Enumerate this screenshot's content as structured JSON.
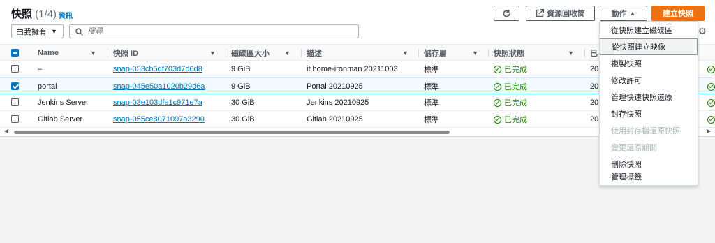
{
  "header": {
    "title": "快照",
    "count": "(1/4)",
    "info": "資訊"
  },
  "toolbar": {
    "recycle_label": "資源回收筒",
    "actions_label": "動作",
    "create_label": "建立快照"
  },
  "filter": {
    "owner_value": "由我擁有",
    "search_placeholder": "搜尋"
  },
  "columns": [
    "Name",
    "快照 ID",
    "磁碟區大小",
    "描述",
    "儲存層",
    "快照狀態",
    "已"
  ],
  "rows": [
    {
      "name": "–",
      "id": "snap-053cb5df703d7d6d8",
      "size": "9 GiB",
      "desc": "it home-ironman 20211003",
      "tier": "標準",
      "status": "已完成",
      "started": "20",
      "selected": false
    },
    {
      "name": "portal",
      "id": "snap-045e50a1020b29d6a",
      "size": "9 GiB",
      "desc": "Portal 20210925",
      "tier": "標準",
      "status": "已完成",
      "started": "20",
      "selected": true
    },
    {
      "name": "Jenkins Server",
      "id": "snap-03e103dfe1c971e7a",
      "size": "30 GiB",
      "desc": "Jenkins 20210925",
      "tier": "標準",
      "status": "已完成",
      "started": "20",
      "selected": false
    },
    {
      "name": "Gitlab Server",
      "id": "snap-055ce8071097a3290",
      "size": "30 GiB",
      "desc": "Gitlab 20210925",
      "tier": "標準",
      "status": "已完成",
      "started": "20",
      "selected": false
    }
  ],
  "actions_menu": [
    {
      "label": "從快照建立磁碟區",
      "disabled": false
    },
    {
      "label": "從快照建立映像",
      "disabled": false,
      "hover": true
    },
    {
      "label": "複製快照",
      "disabled": false
    },
    {
      "label": "修改許可",
      "disabled": false
    },
    {
      "label": "管理快速快照還原",
      "disabled": false
    },
    {
      "label": "封存快照",
      "disabled": false
    },
    {
      "label": "使用封存檔還原快照",
      "disabled": true
    },
    {
      "label": "變更還原期間",
      "disabled": true
    },
    {
      "label": "刪除快照",
      "disabled": false
    },
    {
      "label": "管理標籤",
      "disabled": false
    }
  ],
  "icons": {
    "refresh": "refresh-icon",
    "external": "external-link-icon",
    "caret_up": "caret-up-icon",
    "search": "search-icon",
    "gear": "gear-icon",
    "check_circle": "check-circle-icon"
  },
  "colors": {
    "primary": "#ec7211",
    "link": "#0073bb",
    "success": "#1d8102"
  }
}
